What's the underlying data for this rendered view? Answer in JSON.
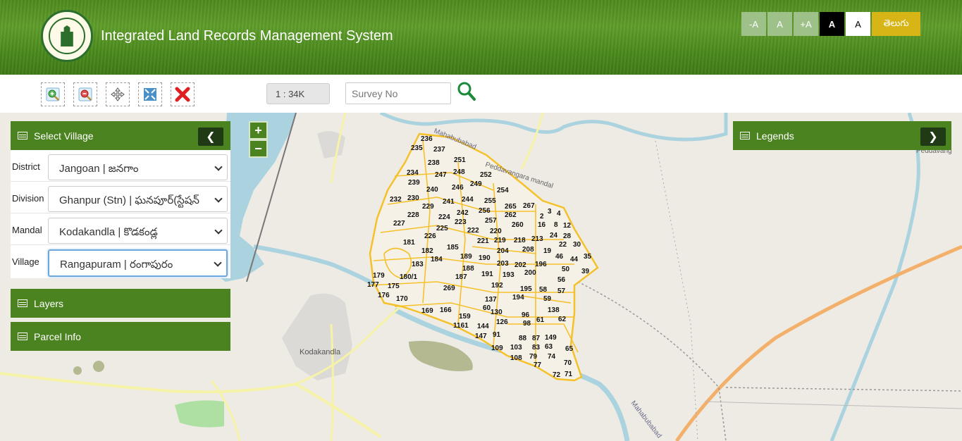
{
  "header": {
    "title": "Integrated Land Records Management System",
    "font_buttons": [
      {
        "label": "-A"
      },
      {
        "label": "A"
      },
      {
        "label": "+A"
      },
      {
        "label": "A"
      },
      {
        "label": "A"
      },
      {
        "label": "తెలుగు"
      }
    ]
  },
  "toolbar": {
    "tools": [
      "zoom-in-tool",
      "zoom-out-tool",
      "pan-tool",
      "full-extent-tool",
      "clear-tool"
    ],
    "scale": "1 : 34K",
    "search_placeholder": "Survey No"
  },
  "select_village": {
    "title": "Select Village",
    "fields": [
      {
        "label": "District",
        "value": "Jangoan | జనగాం"
      },
      {
        "label": "Division",
        "value": "Ghanpur (Stn) | ఘనపూర్(స్టేషన్"
      },
      {
        "label": "Mandal",
        "value": "Kodakandla | కొడకండ్ల"
      },
      {
        "label": "Village",
        "value": "Rangapuram | రంగాపురం"
      }
    ]
  },
  "layers": {
    "title": "Layers"
  },
  "parcel_info": {
    "title": "Parcel Info"
  },
  "legends": {
    "title": "Legends"
  },
  "map": {
    "zoom_in": "+",
    "zoom_out": "−",
    "place_labels": [
      "Kodakandla",
      "Mahabubabad",
      "Peddavangara mandal",
      "Mahabubabad",
      "Peddavang"
    ],
    "parcels": [
      "236",
      "235",
      "237",
      "251",
      "238",
      "234",
      "247",
      "248",
      "252",
      "239",
      "246",
      "249",
      "240",
      "254",
      "232",
      "230",
      "241",
      "244",
      "255",
      "229",
      "265",
      "267",
      "228",
      "242",
      "256",
      "262",
      "3",
      "4",
      "224",
      "257",
      "2",
      "227",
      "223",
      "260",
      "16",
      "8",
      "12",
      "225",
      "222",
      "220",
      "24",
      "28",
      "226",
      "221",
      "219",
      "218",
      "213",
      "22",
      "30",
      "181",
      "182",
      "185",
      "204",
      "208",
      "19",
      "35",
      "184",
      "189",
      "190",
      "203",
      "202",
      "196",
      "46",
      "44",
      "183",
      "188",
      "200",
      "50",
      "39",
      "179",
      "180/1",
      "187",
      "191",
      "193",
      "56",
      "177",
      "175",
      "269",
      "192",
      "195",
      "58",
      "57",
      "176",
      "170",
      "194",
      "137",
      "59",
      "60",
      "138",
      "169",
      "166",
      "130",
      "96",
      "159",
      "126",
      "61",
      "62",
      "1161",
      "98",
      "144",
      "147",
      "91",
      "88",
      "87",
      "149",
      "109",
      "103",
      "83",
      "63",
      "65",
      "108",
      "79",
      "74",
      "70",
      "77",
      "72",
      "71"
    ],
    "parcel_color": "#f5c12a"
  }
}
